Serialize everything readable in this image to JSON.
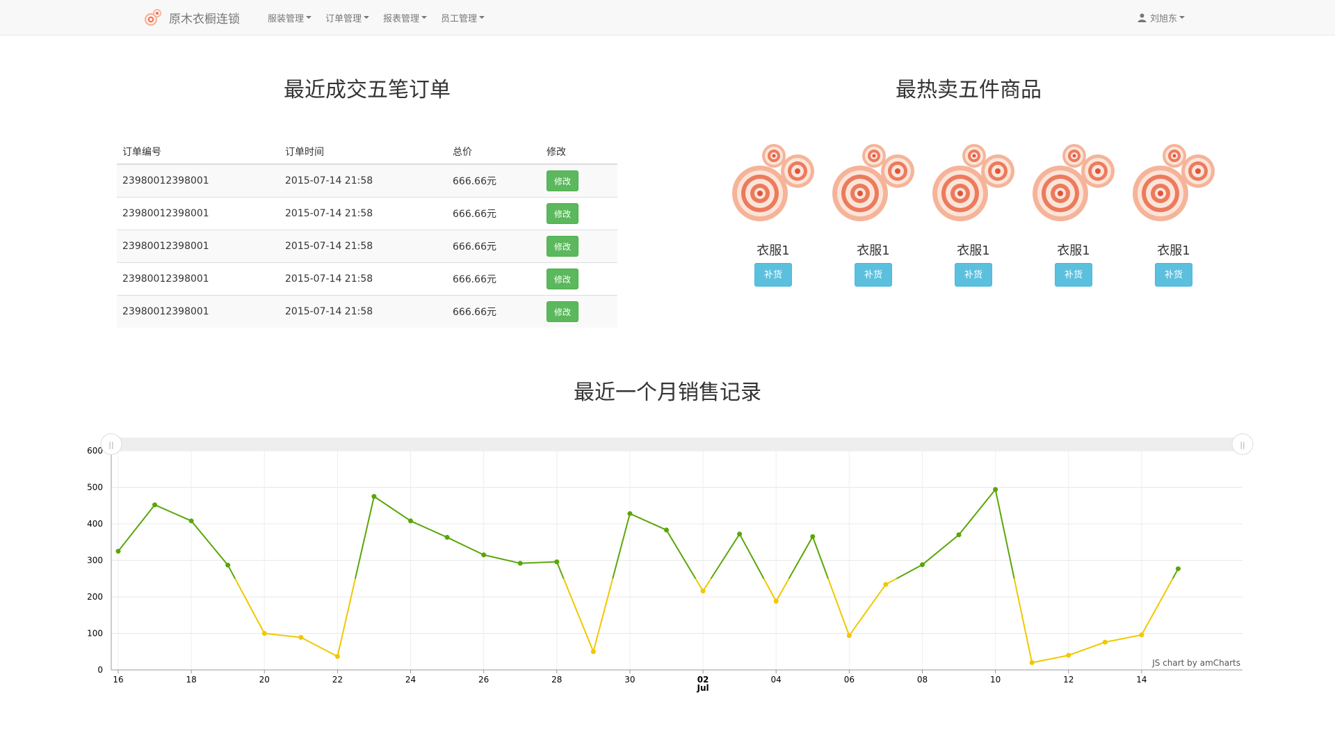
{
  "navbar": {
    "brand": "原木衣橱连锁",
    "menus": [
      "服装管理",
      "订单管理",
      "报表管理",
      "员工管理"
    ],
    "user": "刘旭东"
  },
  "orders": {
    "title": "最近成交五笔订单",
    "headers": [
      "订单编号",
      "订单时间",
      "总价",
      "修改"
    ],
    "rows": [
      {
        "id": "23980012398001",
        "time": "2015-07-14 21:58",
        "price": "666.66元",
        "action": "修改"
      },
      {
        "id": "23980012398001",
        "time": "2015-07-14 21:58",
        "price": "666.66元",
        "action": "修改"
      },
      {
        "id": "23980012398001",
        "time": "2015-07-14 21:58",
        "price": "666.66元",
        "action": "修改"
      },
      {
        "id": "23980012398001",
        "time": "2015-07-14 21:58",
        "price": "666.66元",
        "action": "修改"
      },
      {
        "id": "23980012398001",
        "time": "2015-07-14 21:58",
        "price": "666.66元",
        "action": "修改"
      }
    ]
  },
  "hot": {
    "title": "最热卖五件商品",
    "products": [
      {
        "name": "衣服1",
        "action": "补货"
      },
      {
        "name": "衣服1",
        "action": "补货"
      },
      {
        "name": "衣服1",
        "action": "补货"
      },
      {
        "name": "衣服1",
        "action": "补货"
      },
      {
        "name": "衣服1",
        "action": "补货"
      }
    ]
  },
  "colors": {
    "series_above": "#5aa60a",
    "series_below": "#f0c800",
    "edit_button": "#5cb85c",
    "restock_button": "#5bc0de"
  },
  "icons": [
    "target-logo-icon",
    "caret-down-icon",
    "user-icon",
    "target-product-icon",
    "scrollbar-grip-icon"
  ],
  "chart_data": {
    "type": "line",
    "title": "最近一个月销售记录",
    "credit": "JS chart by amCharts",
    "threshold": 250,
    "ylim": [
      0,
      600
    ],
    "yticks": [
      0,
      100,
      200,
      300,
      400,
      500,
      600
    ],
    "x_range": [
      "2015-06-16",
      "2015-07-16"
    ],
    "xticks": [
      {
        "date": "2015-06-16",
        "label": "16"
      },
      {
        "date": "2015-06-18",
        "label": "18"
      },
      {
        "date": "2015-06-20",
        "label": "20"
      },
      {
        "date": "2015-06-22",
        "label": "22"
      },
      {
        "date": "2015-06-24",
        "label": "24"
      },
      {
        "date": "2015-06-26",
        "label": "26"
      },
      {
        "date": "2015-06-28",
        "label": "28"
      },
      {
        "date": "2015-06-30",
        "label": "30"
      },
      {
        "date": "2015-07-02",
        "label": "02",
        "sublabel": "Jul"
      },
      {
        "date": "2015-07-04",
        "label": "04"
      },
      {
        "date": "2015-07-06",
        "label": "06"
      },
      {
        "date": "2015-07-08",
        "label": "08"
      },
      {
        "date": "2015-07-10",
        "label": "10"
      },
      {
        "date": "2015-07-12",
        "label": "12"
      },
      {
        "date": "2015-07-14",
        "label": "14"
      }
    ],
    "series": [
      {
        "points": [
          {
            "x": "2015-06-16",
            "y": 325
          },
          {
            "x": "2015-06-17",
            "y": 452
          },
          {
            "x": "2015-06-18",
            "y": 408
          },
          {
            "x": "2015-06-19",
            "y": 287
          },
          {
            "x": "2015-06-20",
            "y": 100
          },
          {
            "x": "2015-06-21",
            "y": 89
          },
          {
            "x": "2015-06-22",
            "y": 37
          },
          {
            "x": "2015-06-23",
            "y": 475
          },
          {
            "x": "2015-06-24",
            "y": 408
          },
          {
            "x": "2015-06-25",
            "y": 363
          },
          {
            "x": "2015-06-26",
            "y": 315
          },
          {
            "x": "2015-06-27",
            "y": 292
          },
          {
            "x": "2015-06-28",
            "y": 296
          },
          {
            "x": "2015-06-29",
            "y": 50
          },
          {
            "x": "2015-06-30",
            "y": 428
          },
          {
            "x": "2015-07-01",
            "y": 383
          },
          {
            "x": "2015-07-02",
            "y": 216
          },
          {
            "x": "2015-07-03",
            "y": 372
          },
          {
            "x": "2015-07-04",
            "y": 188
          },
          {
            "x": "2015-07-05",
            "y": 365
          },
          {
            "x": "2015-07-06",
            "y": 94
          },
          {
            "x": "2015-07-07",
            "y": 234
          },
          {
            "x": "2015-07-08",
            "y": 288
          },
          {
            "x": "2015-07-09",
            "y": 370
          },
          {
            "x": "2015-07-10",
            "y": 494
          },
          {
            "x": "2015-07-11",
            "y": 20
          },
          {
            "x": "2015-07-12",
            "y": 40
          },
          {
            "x": "2015-07-13",
            "y": 76
          },
          {
            "x": "2015-07-14",
            "y": 96
          },
          {
            "x": "2015-07-15",
            "y": 277
          }
        ]
      }
    ]
  }
}
